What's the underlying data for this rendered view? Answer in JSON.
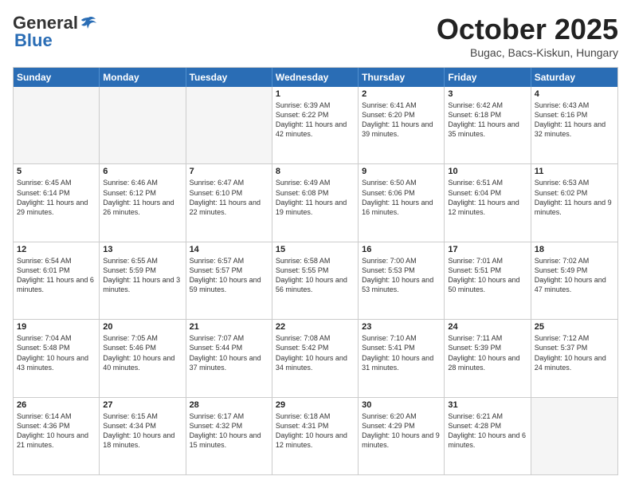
{
  "logo": {
    "general": "General",
    "blue": "Blue"
  },
  "title": "October 2025",
  "location": "Bugac, Bacs-Kiskun, Hungary",
  "days_of_week": [
    "Sunday",
    "Monday",
    "Tuesday",
    "Wednesday",
    "Thursday",
    "Friday",
    "Saturday"
  ],
  "weeks": [
    [
      {
        "day": "",
        "sunrise": "",
        "sunset": "",
        "daylight": ""
      },
      {
        "day": "",
        "sunrise": "",
        "sunset": "",
        "daylight": ""
      },
      {
        "day": "",
        "sunrise": "",
        "sunset": "",
        "daylight": ""
      },
      {
        "day": "1",
        "sunrise": "Sunrise: 6:39 AM",
        "sunset": "Sunset: 6:22 PM",
        "daylight": "Daylight: 11 hours and 42 minutes."
      },
      {
        "day": "2",
        "sunrise": "Sunrise: 6:41 AM",
        "sunset": "Sunset: 6:20 PM",
        "daylight": "Daylight: 11 hours and 39 minutes."
      },
      {
        "day": "3",
        "sunrise": "Sunrise: 6:42 AM",
        "sunset": "Sunset: 6:18 PM",
        "daylight": "Daylight: 11 hours and 35 minutes."
      },
      {
        "day": "4",
        "sunrise": "Sunrise: 6:43 AM",
        "sunset": "Sunset: 6:16 PM",
        "daylight": "Daylight: 11 hours and 32 minutes."
      }
    ],
    [
      {
        "day": "5",
        "sunrise": "Sunrise: 6:45 AM",
        "sunset": "Sunset: 6:14 PM",
        "daylight": "Daylight: 11 hours and 29 minutes."
      },
      {
        "day": "6",
        "sunrise": "Sunrise: 6:46 AM",
        "sunset": "Sunset: 6:12 PM",
        "daylight": "Daylight: 11 hours and 26 minutes."
      },
      {
        "day": "7",
        "sunrise": "Sunrise: 6:47 AM",
        "sunset": "Sunset: 6:10 PM",
        "daylight": "Daylight: 11 hours and 22 minutes."
      },
      {
        "day": "8",
        "sunrise": "Sunrise: 6:49 AM",
        "sunset": "Sunset: 6:08 PM",
        "daylight": "Daylight: 11 hours and 19 minutes."
      },
      {
        "day": "9",
        "sunrise": "Sunrise: 6:50 AM",
        "sunset": "Sunset: 6:06 PM",
        "daylight": "Daylight: 11 hours and 16 minutes."
      },
      {
        "day": "10",
        "sunrise": "Sunrise: 6:51 AM",
        "sunset": "Sunset: 6:04 PM",
        "daylight": "Daylight: 11 hours and 12 minutes."
      },
      {
        "day": "11",
        "sunrise": "Sunrise: 6:53 AM",
        "sunset": "Sunset: 6:02 PM",
        "daylight": "Daylight: 11 hours and 9 minutes."
      }
    ],
    [
      {
        "day": "12",
        "sunrise": "Sunrise: 6:54 AM",
        "sunset": "Sunset: 6:01 PM",
        "daylight": "Daylight: 11 hours and 6 minutes."
      },
      {
        "day": "13",
        "sunrise": "Sunrise: 6:55 AM",
        "sunset": "Sunset: 5:59 PM",
        "daylight": "Daylight: 11 hours and 3 minutes."
      },
      {
        "day": "14",
        "sunrise": "Sunrise: 6:57 AM",
        "sunset": "Sunset: 5:57 PM",
        "daylight": "Daylight: 10 hours and 59 minutes."
      },
      {
        "day": "15",
        "sunrise": "Sunrise: 6:58 AM",
        "sunset": "Sunset: 5:55 PM",
        "daylight": "Daylight: 10 hours and 56 minutes."
      },
      {
        "day": "16",
        "sunrise": "Sunrise: 7:00 AM",
        "sunset": "Sunset: 5:53 PM",
        "daylight": "Daylight: 10 hours and 53 minutes."
      },
      {
        "day": "17",
        "sunrise": "Sunrise: 7:01 AM",
        "sunset": "Sunset: 5:51 PM",
        "daylight": "Daylight: 10 hours and 50 minutes."
      },
      {
        "day": "18",
        "sunrise": "Sunrise: 7:02 AM",
        "sunset": "Sunset: 5:49 PM",
        "daylight": "Daylight: 10 hours and 47 minutes."
      }
    ],
    [
      {
        "day": "19",
        "sunrise": "Sunrise: 7:04 AM",
        "sunset": "Sunset: 5:48 PM",
        "daylight": "Daylight: 10 hours and 43 minutes."
      },
      {
        "day": "20",
        "sunrise": "Sunrise: 7:05 AM",
        "sunset": "Sunset: 5:46 PM",
        "daylight": "Daylight: 10 hours and 40 minutes."
      },
      {
        "day": "21",
        "sunrise": "Sunrise: 7:07 AM",
        "sunset": "Sunset: 5:44 PM",
        "daylight": "Daylight: 10 hours and 37 minutes."
      },
      {
        "day": "22",
        "sunrise": "Sunrise: 7:08 AM",
        "sunset": "Sunset: 5:42 PM",
        "daylight": "Daylight: 10 hours and 34 minutes."
      },
      {
        "day": "23",
        "sunrise": "Sunrise: 7:10 AM",
        "sunset": "Sunset: 5:41 PM",
        "daylight": "Daylight: 10 hours and 31 minutes."
      },
      {
        "day": "24",
        "sunrise": "Sunrise: 7:11 AM",
        "sunset": "Sunset: 5:39 PM",
        "daylight": "Daylight: 10 hours and 28 minutes."
      },
      {
        "day": "25",
        "sunrise": "Sunrise: 7:12 AM",
        "sunset": "Sunset: 5:37 PM",
        "daylight": "Daylight: 10 hours and 24 minutes."
      }
    ],
    [
      {
        "day": "26",
        "sunrise": "Sunrise: 6:14 AM",
        "sunset": "Sunset: 4:36 PM",
        "daylight": "Daylight: 10 hours and 21 minutes."
      },
      {
        "day": "27",
        "sunrise": "Sunrise: 6:15 AM",
        "sunset": "Sunset: 4:34 PM",
        "daylight": "Daylight: 10 hours and 18 minutes."
      },
      {
        "day": "28",
        "sunrise": "Sunrise: 6:17 AM",
        "sunset": "Sunset: 4:32 PM",
        "daylight": "Daylight: 10 hours and 15 minutes."
      },
      {
        "day": "29",
        "sunrise": "Sunrise: 6:18 AM",
        "sunset": "Sunset: 4:31 PM",
        "daylight": "Daylight: 10 hours and 12 minutes."
      },
      {
        "day": "30",
        "sunrise": "Sunrise: 6:20 AM",
        "sunset": "Sunset: 4:29 PM",
        "daylight": "Daylight: 10 hours and 9 minutes."
      },
      {
        "day": "31",
        "sunrise": "Sunrise: 6:21 AM",
        "sunset": "Sunset: 4:28 PM",
        "daylight": "Daylight: 10 hours and 6 minutes."
      },
      {
        "day": "",
        "sunrise": "",
        "sunset": "",
        "daylight": ""
      }
    ]
  ]
}
